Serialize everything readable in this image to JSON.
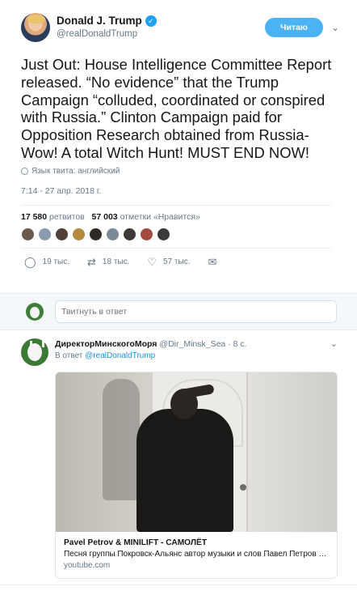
{
  "tweet": {
    "name": "Donald J. Trump",
    "handle": "@realDonaldTrump",
    "follow_label": "Читаю",
    "text": "Just Out: House Intelligence Committee Report released. “No evidence” that the Trump Campaign “colluded, coordinated or conspired with Russia.” Clinton Campaign paid for Opposition Research obtained from Russia- Wow! A total Witch Hunt! MUST END NOW!",
    "language": "Язык твита: английский",
    "timestamp": "7:14 - 27 апр. 2018 г.",
    "retweets_count": "17 580",
    "retweets_label": "ретвитов",
    "likes_count": "57 003",
    "likes_label": "отметки «Нравится»",
    "likers_colors": [
      "#6b5b4e",
      "#8a9bb0",
      "#4e4036",
      "#b58a3c",
      "#2d2a28",
      "#7b8a99",
      "#3d3a35",
      "#a44a3f",
      "#3a3a3a"
    ],
    "actions": {
      "replies": "19 тыс.",
      "retweets": "18 тыс.",
      "likes": "57 тыс."
    }
  },
  "reply_box": {
    "placeholder": "Твитнуть в ответ"
  },
  "reply": {
    "name": "ДиректорМинскогоМоря",
    "handle": "@Dir_Minsk_Sea",
    "time": "· 8 с.",
    "in_reply_prefix": "В ответ",
    "in_reply_handle": "@realDonaldTrump",
    "card": {
      "title": "Pavel Petrov & MINILIFT - САМОЛЁТ",
      "description": "Песня группы Покровск-Альянс автор музыки и слов Павел Петров htt...",
      "domain": "youtube.com"
    }
  }
}
